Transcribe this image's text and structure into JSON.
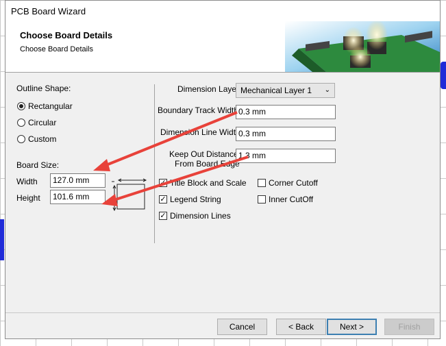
{
  "window": {
    "title": "PCB Board Wizard"
  },
  "header": {
    "title": "Choose Board Details",
    "subtitle": "Choose Board Details"
  },
  "outline": {
    "label": "Outline Shape:",
    "options": [
      {
        "label": "Rectangular",
        "selected": true
      },
      {
        "label": "Circular",
        "selected": false
      },
      {
        "label": "Custom",
        "selected": false
      }
    ]
  },
  "board_size": {
    "label": "Board Size:",
    "width_label": "Width",
    "width_value": "127.0 mm",
    "height_label": "Height",
    "height_value": "101.6 mm"
  },
  "dimension_layer": {
    "label": "Dimension Layer",
    "value": "Mechanical Layer 1"
  },
  "boundary_track_width": {
    "label": "Boundary Track Width",
    "value": "0.3 mm"
  },
  "dimension_line_width": {
    "label": "Dimension Line Width",
    "value": "0.3 mm"
  },
  "keep_out": {
    "label_line1": "Keep Out Distance",
    "label_line2": "From Board Edge",
    "value": "1.3 mm"
  },
  "checkboxes": [
    {
      "label": "Title Block and Scale",
      "checked": true
    },
    {
      "label": "Legend String",
      "checked": true
    },
    {
      "label": "Dimension Lines",
      "checked": true
    },
    {
      "label": "Corner Cutoff",
      "checked": false
    },
    {
      "label": "Inner CutOff",
      "checked": false
    }
  ],
  "buttons": {
    "cancel": "Cancel",
    "back": "< Back",
    "next": "Next >",
    "finish": "Finish"
  },
  "colors": {
    "annotation_arrow": "#e8423a",
    "default_button_border": "#3c7fb1"
  },
  "icons": {
    "check": "✓",
    "combo_arrow": "⌄"
  }
}
